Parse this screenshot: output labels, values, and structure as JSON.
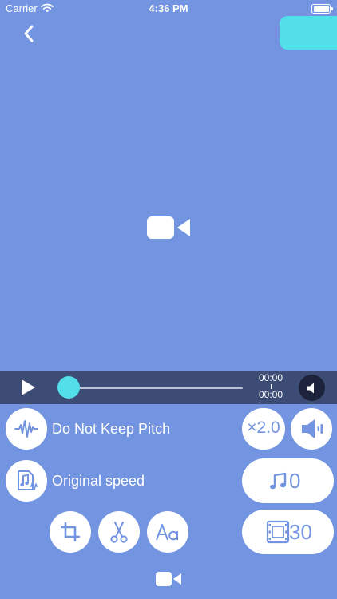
{
  "status_bar": {
    "carrier": "Carrier",
    "time": "4:36 PM"
  },
  "player": {
    "current_time": "00:00",
    "total_time": "00:00",
    "progress": 0
  },
  "controls": {
    "pitch_label": "Do Not Keep Pitch",
    "speed_label": "Original speed",
    "speed_multiplier": "×2.0",
    "music_value": "0",
    "frame_value": "30"
  },
  "colors": {
    "background": "#7394e0",
    "accent": "#52dfea",
    "player_bar": "#3d4c75",
    "button": "#ffffff"
  },
  "icons": {
    "back": "chevron-left-icon",
    "camera": "video-camera-icon",
    "play": "play-icon",
    "mute": "speaker-icon",
    "waveform": "waveform-icon",
    "music_file": "music-file-icon",
    "volume": "volume-icon",
    "music_note": "music-note-icon",
    "film": "film-icon",
    "crop": "crop-icon",
    "scissors": "scissors-icon",
    "text": "text-icon"
  }
}
